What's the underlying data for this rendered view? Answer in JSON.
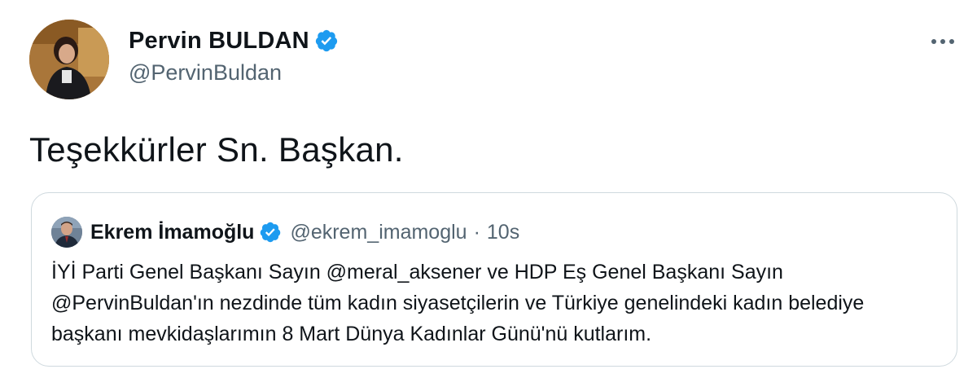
{
  "author": {
    "display_name": "Pervin BULDAN",
    "handle": "@PervinBuldan",
    "verified": true
  },
  "tweet": {
    "text": "Teşekkürler Sn. Başkan."
  },
  "quoted_tweet": {
    "display_name": "Ekrem İmamoğlu",
    "handle": "@ekrem_imamoglu",
    "separator": "·",
    "time": "10s",
    "verified": true,
    "text": "İYİ Parti Genel Başkanı Sayın @meral_aksener ve HDP Eş Genel Başkanı Sayın @PervinBuldan'ın nezdinde tüm kadın siyasetçilerin ve Türkiye genelindeki kadın belediye başkanı mevkidaşlarımın 8 Mart Dünya Kadınlar Günü'nü kutlarım."
  },
  "icons": {
    "verified": "verified-badge-icon",
    "more": "more-options-icon"
  },
  "colors": {
    "verified_blue": "#1d9bf0",
    "text_primary": "#0f1419",
    "text_secondary": "#536471",
    "border": "#cfd9de"
  }
}
